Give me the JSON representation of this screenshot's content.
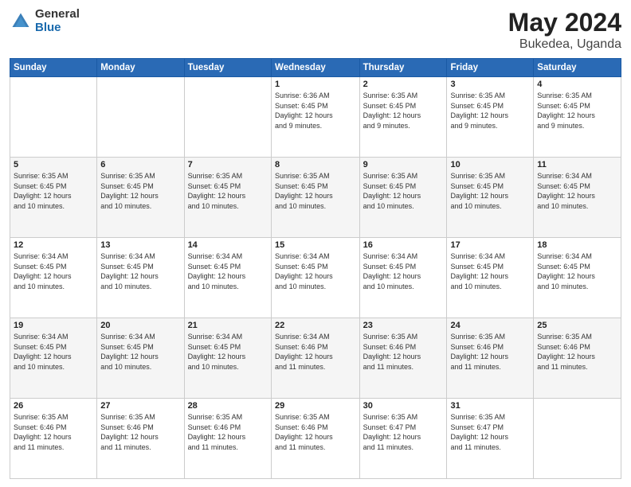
{
  "logo": {
    "general": "General",
    "blue": "Blue"
  },
  "title": {
    "month": "May 2024",
    "location": "Bukedea, Uganda"
  },
  "weekdays": [
    "Sunday",
    "Monday",
    "Tuesday",
    "Wednesday",
    "Thursday",
    "Friday",
    "Saturday"
  ],
  "weeks": [
    [
      {
        "day": "",
        "info": ""
      },
      {
        "day": "",
        "info": ""
      },
      {
        "day": "",
        "info": ""
      },
      {
        "day": "1",
        "info": "Sunrise: 6:36 AM\nSunset: 6:45 PM\nDaylight: 12 hours\nand 9 minutes."
      },
      {
        "day": "2",
        "info": "Sunrise: 6:35 AM\nSunset: 6:45 PM\nDaylight: 12 hours\nand 9 minutes."
      },
      {
        "day": "3",
        "info": "Sunrise: 6:35 AM\nSunset: 6:45 PM\nDaylight: 12 hours\nand 9 minutes."
      },
      {
        "day": "4",
        "info": "Sunrise: 6:35 AM\nSunset: 6:45 PM\nDaylight: 12 hours\nand 9 minutes."
      }
    ],
    [
      {
        "day": "5",
        "info": "Sunrise: 6:35 AM\nSunset: 6:45 PM\nDaylight: 12 hours\nand 10 minutes."
      },
      {
        "day": "6",
        "info": "Sunrise: 6:35 AM\nSunset: 6:45 PM\nDaylight: 12 hours\nand 10 minutes."
      },
      {
        "day": "7",
        "info": "Sunrise: 6:35 AM\nSunset: 6:45 PM\nDaylight: 12 hours\nand 10 minutes."
      },
      {
        "day": "8",
        "info": "Sunrise: 6:35 AM\nSunset: 6:45 PM\nDaylight: 12 hours\nand 10 minutes."
      },
      {
        "day": "9",
        "info": "Sunrise: 6:35 AM\nSunset: 6:45 PM\nDaylight: 12 hours\nand 10 minutes."
      },
      {
        "day": "10",
        "info": "Sunrise: 6:35 AM\nSunset: 6:45 PM\nDaylight: 12 hours\nand 10 minutes."
      },
      {
        "day": "11",
        "info": "Sunrise: 6:34 AM\nSunset: 6:45 PM\nDaylight: 12 hours\nand 10 minutes."
      }
    ],
    [
      {
        "day": "12",
        "info": "Sunrise: 6:34 AM\nSunset: 6:45 PM\nDaylight: 12 hours\nand 10 minutes."
      },
      {
        "day": "13",
        "info": "Sunrise: 6:34 AM\nSunset: 6:45 PM\nDaylight: 12 hours\nand 10 minutes."
      },
      {
        "day": "14",
        "info": "Sunrise: 6:34 AM\nSunset: 6:45 PM\nDaylight: 12 hours\nand 10 minutes."
      },
      {
        "day": "15",
        "info": "Sunrise: 6:34 AM\nSunset: 6:45 PM\nDaylight: 12 hours\nand 10 minutes."
      },
      {
        "day": "16",
        "info": "Sunrise: 6:34 AM\nSunset: 6:45 PM\nDaylight: 12 hours\nand 10 minutes."
      },
      {
        "day": "17",
        "info": "Sunrise: 6:34 AM\nSunset: 6:45 PM\nDaylight: 12 hours\nand 10 minutes."
      },
      {
        "day": "18",
        "info": "Sunrise: 6:34 AM\nSunset: 6:45 PM\nDaylight: 12 hours\nand 10 minutes."
      }
    ],
    [
      {
        "day": "19",
        "info": "Sunrise: 6:34 AM\nSunset: 6:45 PM\nDaylight: 12 hours\nand 10 minutes."
      },
      {
        "day": "20",
        "info": "Sunrise: 6:34 AM\nSunset: 6:45 PM\nDaylight: 12 hours\nand 10 minutes."
      },
      {
        "day": "21",
        "info": "Sunrise: 6:34 AM\nSunset: 6:45 PM\nDaylight: 12 hours\nand 10 minutes."
      },
      {
        "day": "22",
        "info": "Sunrise: 6:34 AM\nSunset: 6:46 PM\nDaylight: 12 hours\nand 11 minutes."
      },
      {
        "day": "23",
        "info": "Sunrise: 6:35 AM\nSunset: 6:46 PM\nDaylight: 12 hours\nand 11 minutes."
      },
      {
        "day": "24",
        "info": "Sunrise: 6:35 AM\nSunset: 6:46 PM\nDaylight: 12 hours\nand 11 minutes."
      },
      {
        "day": "25",
        "info": "Sunrise: 6:35 AM\nSunset: 6:46 PM\nDaylight: 12 hours\nand 11 minutes."
      }
    ],
    [
      {
        "day": "26",
        "info": "Sunrise: 6:35 AM\nSunset: 6:46 PM\nDaylight: 12 hours\nand 11 minutes."
      },
      {
        "day": "27",
        "info": "Sunrise: 6:35 AM\nSunset: 6:46 PM\nDaylight: 12 hours\nand 11 minutes."
      },
      {
        "day": "28",
        "info": "Sunrise: 6:35 AM\nSunset: 6:46 PM\nDaylight: 12 hours\nand 11 minutes."
      },
      {
        "day": "29",
        "info": "Sunrise: 6:35 AM\nSunset: 6:46 PM\nDaylight: 12 hours\nand 11 minutes."
      },
      {
        "day": "30",
        "info": "Sunrise: 6:35 AM\nSunset: 6:47 PM\nDaylight: 12 hours\nand 11 minutes."
      },
      {
        "day": "31",
        "info": "Sunrise: 6:35 AM\nSunset: 6:47 PM\nDaylight: 12 hours\nand 11 minutes."
      },
      {
        "day": "",
        "info": ""
      }
    ]
  ]
}
